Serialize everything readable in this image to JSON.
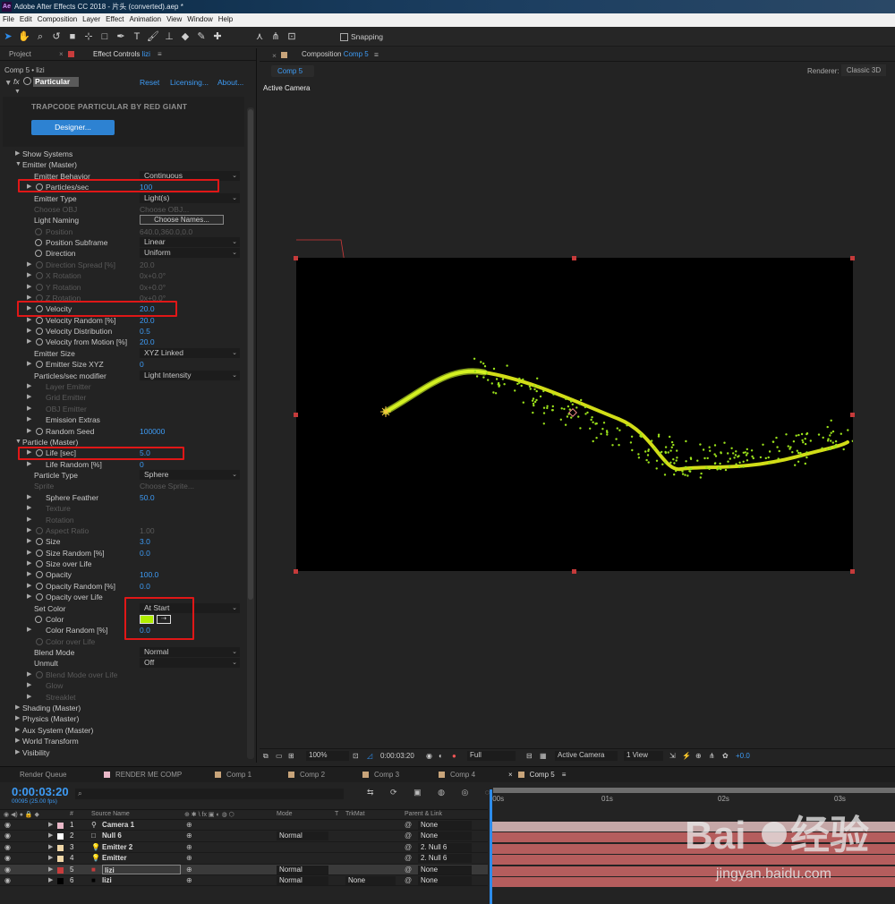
{
  "window": {
    "title": "Adobe After Effects CC 2018 - 片头 (converted).aep *",
    "app_icon": "Ae"
  },
  "menu": [
    "File",
    "Edit",
    "Composition",
    "Layer",
    "Effect",
    "Animation",
    "View",
    "Window",
    "Help"
  ],
  "toolbar": {
    "snapping_label": "Snapping",
    "tools": [
      "selection-icon",
      "hand-icon",
      "zoom-icon",
      "rotate-icon",
      "camera-icon",
      "pan-behind-icon",
      "rectangle-icon",
      "pen-icon",
      "type-icon",
      "brush-icon",
      "clone-stamp-icon",
      "eraser-icon",
      "roto-brush-icon",
      "puppet-pin-icon",
      "axis-local-icon",
      "axis-world-icon",
      "axis-view-icon"
    ]
  },
  "left_panel": {
    "tab_project": "Project",
    "tab_effect_controls": "Effect Controls",
    "effect_layer": "lizi",
    "subtitle": "Comp 5 • lizi",
    "effect_name": "Particular",
    "reset": "Reset",
    "licensing": "Licensing...",
    "about": "About...",
    "brand": "TRAPCODE PARTICULAR BY RED GIANT",
    "designer_button": "Designer...",
    "rows": [
      {
        "label": "Show Systems",
        "indent": 1,
        "tri": true
      },
      {
        "label": "Emitter (Master)",
        "indent": 1,
        "tri": true,
        "open": true
      },
      {
        "label": "Emitter Behavior",
        "indent": 2,
        "dropdown": "Continuous"
      },
      {
        "label": "Particles/sec",
        "indent": 3,
        "tri": true,
        "sw": true,
        "value": "100"
      },
      {
        "label": "Emitter Type",
        "indent": 2,
        "dropdown": "Light(s)"
      },
      {
        "label": "Choose OBJ",
        "indent": 2,
        "dis": true,
        "value": "Choose OBJ..."
      },
      {
        "label": "Light Naming",
        "indent": 2,
        "button": "Choose Names..."
      },
      {
        "label": "Position",
        "indent": 2,
        "dis": true,
        "sw": true,
        "value": "640.0,360.0,0.0"
      },
      {
        "label": "Position Subframe",
        "indent": 2,
        "sw": true,
        "dropdown": "Linear"
      },
      {
        "label": "Direction",
        "indent": 2,
        "sw": true,
        "dropdown": "Uniform"
      },
      {
        "label": "Direction Spread [%]",
        "indent": 3,
        "tri": true,
        "sw": true,
        "dis": true,
        "value": "20.0"
      },
      {
        "label": "X Rotation",
        "indent": 3,
        "tri": true,
        "sw": true,
        "dis": true,
        "value": "0x+0.0°"
      },
      {
        "label": "Y Rotation",
        "indent": 3,
        "tri": true,
        "sw": true,
        "dis": true,
        "value": "0x+0.0°"
      },
      {
        "label": "Z Rotation",
        "indent": 3,
        "tri": true,
        "sw": true,
        "dis": true,
        "value": "0x+0.0°"
      },
      {
        "label": "Velocity",
        "indent": 3,
        "tri": true,
        "sw": true,
        "value": "20.0"
      },
      {
        "label": "Velocity Random [%]",
        "indent": 3,
        "tri": true,
        "sw": true,
        "value": "20.0"
      },
      {
        "label": "Velocity Distribution",
        "indent": 3,
        "tri": true,
        "sw": true,
        "value": "0.5"
      },
      {
        "label": "Velocity from Motion [%]",
        "indent": 3,
        "tri": true,
        "sw": true,
        "value": "20.0"
      },
      {
        "label": "Emitter Size",
        "indent": 2,
        "dropdown": "XYZ Linked"
      },
      {
        "label": "Emitter Size XYZ",
        "indent": 3,
        "tri": true,
        "sw": true,
        "value": "0"
      },
      {
        "label": "Particles/sec modifier",
        "indent": 2,
        "dropdown": "Light Intensity"
      },
      {
        "label": "Layer Emitter",
        "indent": 3,
        "tri": true,
        "dis": true
      },
      {
        "label": "Grid Emitter",
        "indent": 3,
        "tri": true,
        "dis": true
      },
      {
        "label": "OBJ Emitter",
        "indent": 3,
        "tri": true,
        "dis": true
      },
      {
        "label": "Emission Extras",
        "indent": 3,
        "tri": true
      },
      {
        "label": "Random Seed",
        "indent": 3,
        "tri": true,
        "sw": true,
        "value": "100000"
      },
      {
        "label": "Particle (Master)",
        "indent": 1,
        "tri": true,
        "open": true
      },
      {
        "label": "Life [sec]",
        "indent": 3,
        "tri": true,
        "sw": true,
        "value": "5.0"
      },
      {
        "label": "Life Random [%]",
        "indent": 3,
        "tri": true,
        "value": "0"
      },
      {
        "label": "Particle Type",
        "indent": 2,
        "dropdown": "Sphere"
      },
      {
        "label": "Sprite",
        "indent": 2,
        "dis": true,
        "value": "Choose Sprite..."
      },
      {
        "label": "Sphere Feather",
        "indent": 3,
        "tri": true,
        "value": "50.0"
      },
      {
        "label": "Texture",
        "indent": 3,
        "tri": true,
        "dis": true
      },
      {
        "label": "Rotation",
        "indent": 3,
        "tri": true,
        "dis": true
      },
      {
        "label": "Aspect Ratio",
        "indent": 3,
        "tri": true,
        "sw": true,
        "dis": true,
        "value": "1.00"
      },
      {
        "label": "Size",
        "indent": 3,
        "tri": true,
        "sw": true,
        "value": "3.0"
      },
      {
        "label": "Size Random [%]",
        "indent": 3,
        "tri": true,
        "sw": true,
        "value": "0.0"
      },
      {
        "label": "Size over Life",
        "indent": 3,
        "tri": true,
        "sw": true
      },
      {
        "label": "Opacity",
        "indent": 3,
        "tri": true,
        "sw": true,
        "value": "100.0"
      },
      {
        "label": "Opacity Random [%]",
        "indent": 3,
        "tri": true,
        "sw": true,
        "value": "0.0"
      },
      {
        "label": "Opacity over Life",
        "indent": 3,
        "tri": true,
        "sw": true
      },
      {
        "label": "Set Color",
        "indent": 2,
        "dropdown": "At Start"
      },
      {
        "label": "Color",
        "indent": 2,
        "sw": true,
        "color": "#b0ee00"
      },
      {
        "label": "Color Random [%]",
        "indent": 3,
        "tri": true,
        "value": "0.0"
      },
      {
        "label": "Color over Life",
        "indent": 3,
        "sw": true,
        "dis": true
      },
      {
        "label": "Blend Mode",
        "indent": 2,
        "dropdown": "Normal"
      },
      {
        "label": "Unmult",
        "indent": 2,
        "dropdown": "Off"
      },
      {
        "label": "Blend Mode over Life",
        "indent": 3,
        "tri": true,
        "sw": true,
        "dis": true
      },
      {
        "label": "Glow",
        "indent": 3,
        "tri": true,
        "dis": true
      },
      {
        "label": "Streaklet",
        "indent": 3,
        "tri": true,
        "dis": true
      },
      {
        "label": "Shading (Master)",
        "indent": 1,
        "tri": true
      },
      {
        "label": "Physics (Master)",
        "indent": 1,
        "tri": true
      },
      {
        "label": "Aux System (Master)",
        "indent": 1,
        "tri": true
      },
      {
        "label": "World Transform",
        "indent": 1,
        "tri": true
      },
      {
        "label": "Visibility",
        "indent": 1,
        "tri": true
      }
    ]
  },
  "comp_panel": {
    "tab_label": "Composition",
    "comp_name": "Comp 5",
    "sub_tab": "Comp 5",
    "renderer_label": "Renderer:",
    "renderer_value": "Classic 3D",
    "view_label": "Active Camera",
    "zoom": "100%",
    "timecode": "0:00:03:20",
    "resolution": "Full",
    "camera_select": "Active Camera",
    "views": "1 View",
    "exposure": "+0.0",
    "particle_color": "#9be21b",
    "trail_color": "#e9f51a"
  },
  "timeline": {
    "tabs": [
      {
        "label": "Render Queue",
        "color": ""
      },
      {
        "label": "RENDER ME COMP",
        "color": "#e9b8c8"
      },
      {
        "label": "Comp 1",
        "color": "#c8a47a"
      },
      {
        "label": "Comp 2",
        "color": "#c8a47a"
      },
      {
        "label": "Comp 3",
        "color": "#c8a47a"
      },
      {
        "label": "Comp 4",
        "color": "#c8a47a"
      },
      {
        "label": "Comp 5",
        "color": "#c8a47a",
        "active": true
      }
    ],
    "current_time": "0:00:03:20",
    "frame_info": "00095 (25.00 fps)",
    "columns": {
      "num": "#",
      "source": "Source Name",
      "mode": "Mode",
      "t": "T",
      "trkmat": "TrkMat",
      "parent": "Parent & Link"
    },
    "ruler_ticks": [
      ":00s",
      "01s",
      "02s",
      "03s"
    ],
    "layers": [
      {
        "num": "1",
        "name": "Camera 1",
        "color": "#e9b8c8",
        "icon": "camera-icon",
        "mode": "",
        "trkmat": "",
        "parent": "None",
        "bar": "#c5a7a7"
      },
      {
        "num": "2",
        "name": "Null 6",
        "color": "#ffffff",
        "icon": "null-icon",
        "mode": "Normal",
        "trkmat": "",
        "parent": "None",
        "bar": "#b55d5d"
      },
      {
        "num": "3",
        "name": "Emitter 2",
        "color": "#f0d7a7",
        "icon": "light-icon",
        "mode": "",
        "trkmat": "",
        "parent": "2. Null 6",
        "bar": "#b55d5d"
      },
      {
        "num": "4",
        "name": "Emitter",
        "color": "#f0d7a7",
        "icon": "light-icon",
        "mode": "",
        "trkmat": "",
        "parent": "2. Null 6",
        "bar": "#b55d5d"
      },
      {
        "num": "5",
        "name": "lizi",
        "color": "#c83c3c",
        "icon": "solid-icon",
        "mode": "Normal",
        "trkmat": "",
        "parent": "None",
        "bar": "#b55d5d",
        "sel": true
      },
      {
        "num": "6",
        "name": "lizi",
        "color": "#000000",
        "icon": "solid-icon",
        "mode": "Normal",
        "trkmat": "None",
        "parent": "None",
        "bar": "#b55d5d"
      }
    ]
  },
  "watermark": {
    "logo": "Baidu经验",
    "url": "jingyan.baidu.com"
  }
}
